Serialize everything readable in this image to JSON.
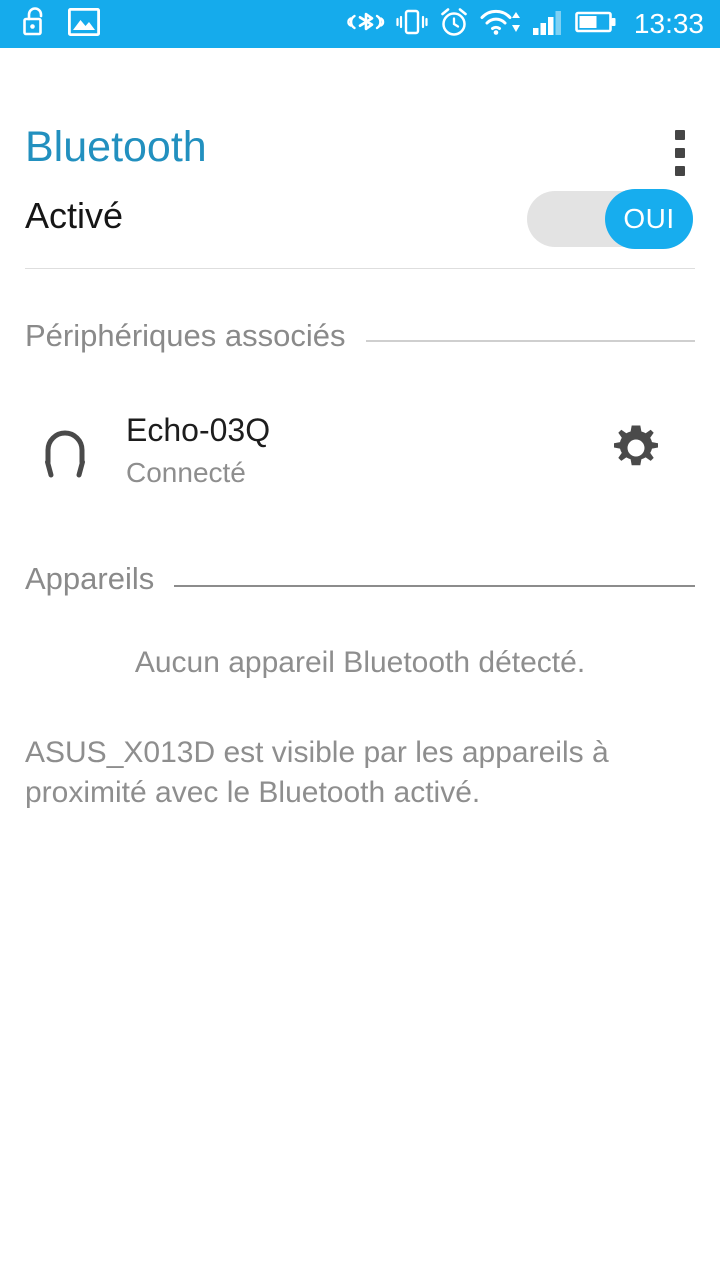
{
  "status_bar": {
    "background_color": "#15abec",
    "clock": "13:33",
    "left_icons": [
      {
        "name": "unlocked-padlock-icon",
        "label": "Unlocked"
      },
      {
        "name": "image-icon",
        "label": "Screenshot saved"
      }
    ],
    "right_icons": [
      {
        "name": "bluetooth-icon",
        "label": "Bluetooth on"
      },
      {
        "name": "vibrate-icon",
        "label": "Vibrate mode"
      },
      {
        "name": "alarm-icon",
        "label": "Alarm set"
      },
      {
        "name": "wifi-icon",
        "label": "Wi-Fi connected"
      },
      {
        "name": "signal-bars-icon",
        "label": "Mobile signal"
      },
      {
        "name": "battery-icon",
        "label": "Battery"
      }
    ]
  },
  "header": {
    "title": "Bluetooth",
    "title_color": "#2290bf",
    "overflow_menu_label": "More options"
  },
  "toggle": {
    "label": "Activé",
    "state_text": "OUI",
    "on": true,
    "accent_color": "#17adee",
    "track_color": "#e3e3e3"
  },
  "sections": {
    "paired": {
      "title": "Périphériques associés",
      "devices": [
        {
          "name": "Echo-03Q",
          "status": "Connecté",
          "icon": "headphones-icon",
          "settings_icon": "gear-icon"
        }
      ]
    },
    "available": {
      "title": "Appareils",
      "empty_message": "Aucun appareil Bluetooth détecté."
    }
  },
  "visibility_note": "ASUS_X013D est visible par les appareils à proximité avec le Bluetooth activé."
}
